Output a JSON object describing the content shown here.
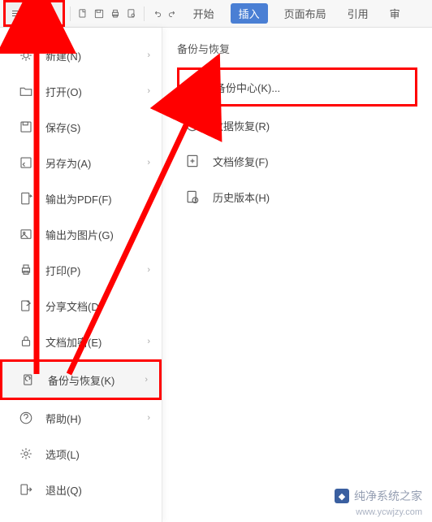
{
  "toolbar": {
    "file_label": "文件",
    "tabs": {
      "start": "开始",
      "insert": "插入",
      "pagelayout": "页面布局",
      "reference": "引用",
      "review": "审"
    }
  },
  "file_menu": {
    "items": [
      {
        "label": "新建(N)",
        "icon": "new",
        "arrow": true
      },
      {
        "label": "打开(O)",
        "icon": "open",
        "arrow": true
      },
      {
        "label": "保存(S)",
        "icon": "save",
        "arrow": false
      },
      {
        "label": "另存为(A)",
        "icon": "saveas",
        "arrow": true
      },
      {
        "label": "输出为PDF(F)",
        "icon": "pdf",
        "arrow": false
      },
      {
        "label": "输出为图片(G)",
        "icon": "image",
        "arrow": false
      },
      {
        "label": "打印(P)",
        "icon": "print",
        "arrow": true
      },
      {
        "label": "分享文档(D)",
        "icon": "share",
        "arrow": false
      },
      {
        "label": "文档加密(E)",
        "icon": "encrypt",
        "arrow": true
      },
      {
        "label": "备份与恢复(K)",
        "icon": "backup",
        "arrow": true,
        "highlight": true
      },
      {
        "label": "帮助(H)",
        "icon": "help",
        "arrow": true
      },
      {
        "label": "选项(L)",
        "icon": "options",
        "arrow": false
      },
      {
        "label": "退出(Q)",
        "icon": "exit",
        "arrow": false
      }
    ]
  },
  "submenu": {
    "title": "备份与恢复",
    "items": [
      {
        "label": "备份中心(K)...",
        "icon": "backup-center",
        "highlight": true
      },
      {
        "label": "数据恢复(R)",
        "icon": "recover"
      },
      {
        "label": "文档修复(F)",
        "icon": "repair"
      },
      {
        "label": "历史版本(H)",
        "icon": "history"
      }
    ]
  },
  "watermark": {
    "line1": "纯净系统之家",
    "line2": "www.ycwjzy.com"
  },
  "annotation": {
    "color": "#ff0000"
  }
}
